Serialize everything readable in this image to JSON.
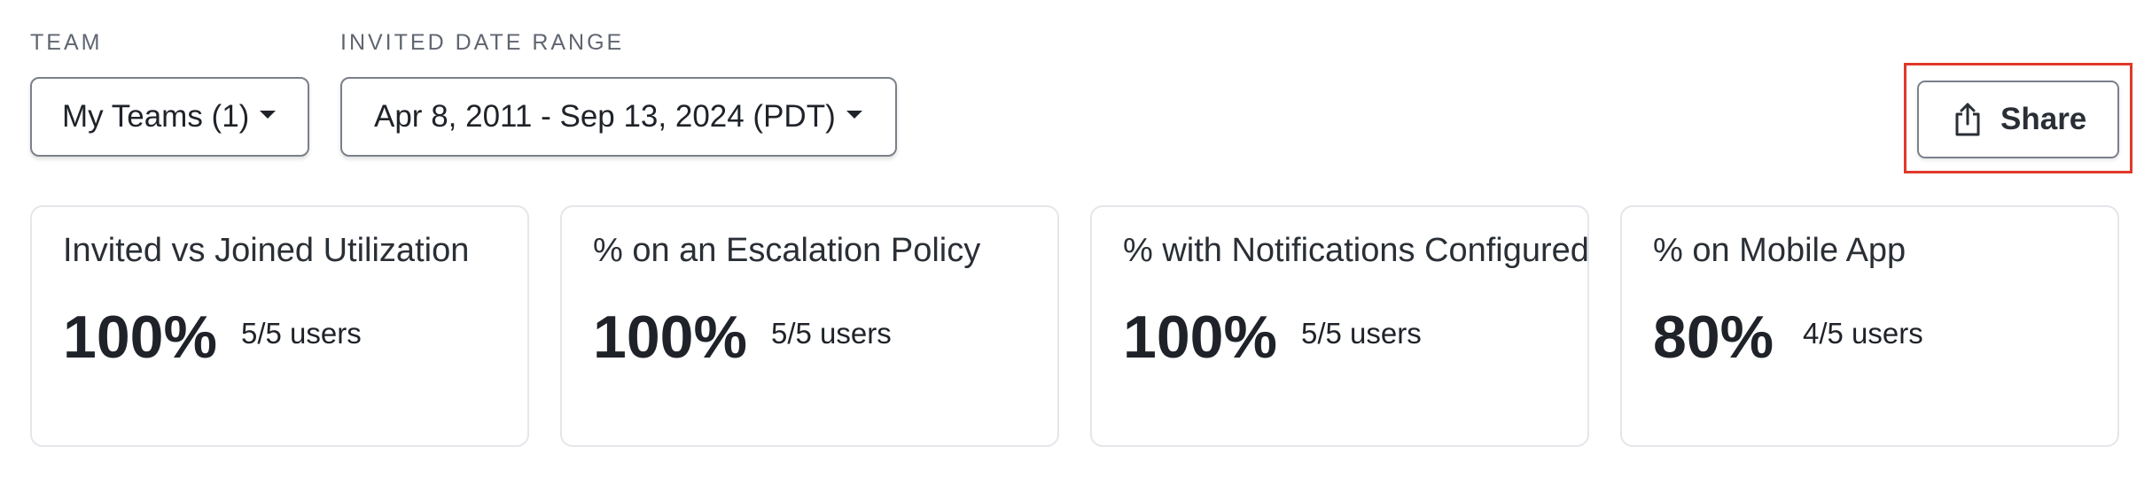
{
  "filters": {
    "team": {
      "label": "TEAM",
      "value": "My Teams (1)"
    },
    "date_range": {
      "label": "INVITED DATE RANGE",
      "value": "Apr 8, 2011 - Sep 13, 2024 (PDT)"
    }
  },
  "share": {
    "label": "Share",
    "icon": "share-icon",
    "highlight_color": "#e0392b"
  },
  "cards": [
    {
      "title": "Invited vs Joined Utilization",
      "value": "100%",
      "sub": "5/5 users"
    },
    {
      "title": "% on an Escalation Policy",
      "value": "100%",
      "sub": "5/5 users"
    },
    {
      "title": "% with Notifications Configured",
      "value": "100%",
      "sub": "5/5 users"
    },
    {
      "title": "% on Mobile App",
      "value": "80%",
      "sub": "4/5 users"
    }
  ]
}
